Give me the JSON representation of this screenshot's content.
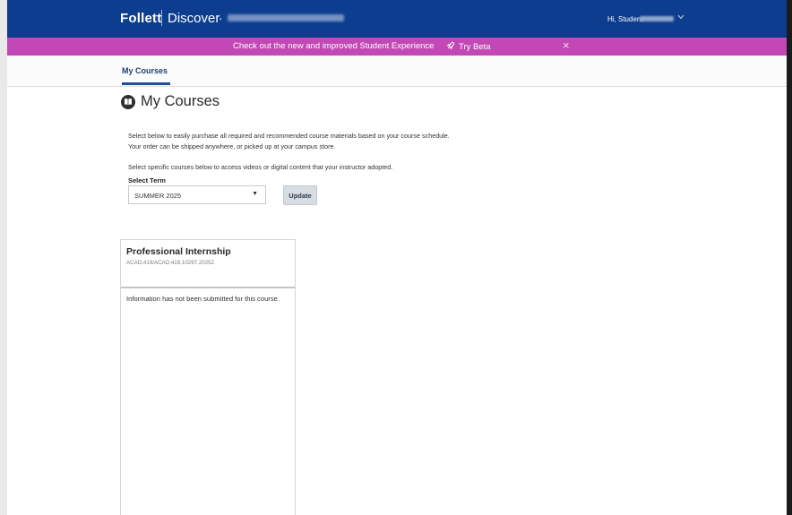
{
  "header": {
    "brand": "Follett",
    "product": "Discover",
    "separator_dot": "·",
    "greeting": "Hi, Student"
  },
  "promo": {
    "text": "Check out the new and improved Student Experience",
    "beta_label": "Try Beta",
    "close_glyph": "×"
  },
  "tabs": [
    {
      "label": "My Courses",
      "active": true
    }
  ],
  "page": {
    "title": "My Courses",
    "intro_line1": "Select below to easily purchase all required and recommended course materials based on your course schedule.",
    "intro_line2": "Your order can be shipped anywhere, or picked up at your campus store.",
    "intro_line3": "Select specific courses below to access videos or digital content that your instructor adopted.",
    "term_label": "Select Term",
    "term_value": "SUMMER 2025",
    "update_label": "Update"
  },
  "course_card": {
    "name": "Professional Internship",
    "code": "ACAD.419/ACAD.419.10297.20252",
    "message": "Information has not been submitted for this course."
  },
  "colors": {
    "header_bg": "#0d3d8e",
    "promo_bg": "#c249b5",
    "tab_accent": "#1d4e9e"
  },
  "icons": {
    "book": "book-circle-icon",
    "rocket": "rocket-icon",
    "close": "close-icon",
    "dropdown": "chevron-down-icon"
  }
}
